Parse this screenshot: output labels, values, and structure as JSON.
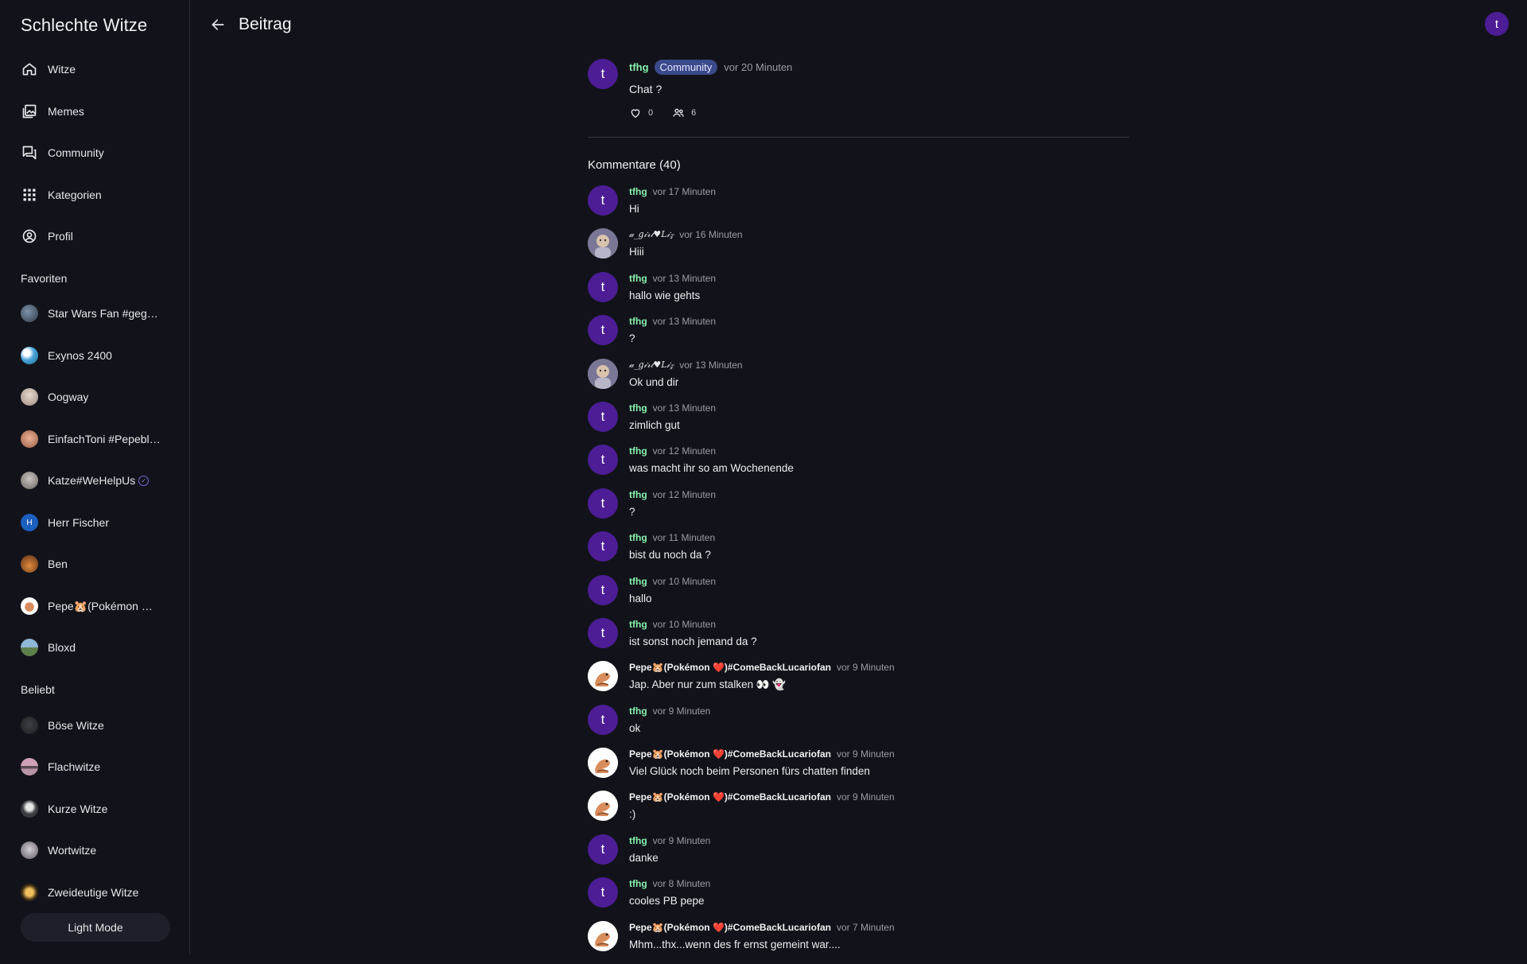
{
  "app": {
    "title": "Schlechte Witze",
    "user_initial": "t"
  },
  "nav": {
    "items": [
      {
        "label": "Witze",
        "icon": "home-icon"
      },
      {
        "label": "Memes",
        "icon": "gallery-icon"
      },
      {
        "label": "Community",
        "icon": "forum-icon"
      },
      {
        "label": "Kategorien",
        "icon": "grid-icon"
      },
      {
        "label": "Profil",
        "icon": "profile-icon"
      }
    ]
  },
  "favorites": {
    "heading": "Favoriten",
    "items": [
      {
        "label": "Star Wars Fan #gegen...",
        "color": "#3a4a5c"
      },
      {
        "label": "Exynos 2400",
        "color": "#4aa3d8"
      },
      {
        "label": "Oogway",
        "color": "#b7a49a"
      },
      {
        "label": "EinfachToni #Pepeblei...",
        "color": "#c4866a"
      },
      {
        "label": "Katze#WeHelpUs",
        "color": "#8d8a86"
      },
      {
        "label": "Herr Fischer",
        "color": "#1d5fbf",
        "initial": "H"
      },
      {
        "label": "Ben",
        "color": "#b5652f"
      },
      {
        "label": "Pepe🐹(Pokémon ❤️)...",
        "color": "#e0b08a"
      },
      {
        "label": "Bloxd",
        "color": "#6c8f6a"
      }
    ]
  },
  "popular": {
    "heading": "Beliebt",
    "items": [
      {
        "label": "Böse Witze",
        "color": "#2b2c30"
      },
      {
        "label": "Flachwitze",
        "color": "#a4708a"
      },
      {
        "label": "Kurze Witze",
        "color": "#5c5f66"
      },
      {
        "label": "Wortwitze",
        "color": "#7b7680"
      },
      {
        "label": "Zweideutige Witze",
        "color": "#8a6a3a"
      }
    ]
  },
  "theme_toggle": {
    "label": "Light Mode"
  },
  "header": {
    "title": "Beitrag"
  },
  "post": {
    "author": "tfhg",
    "initial": "t",
    "badge": "Community",
    "time": "vor 20 Minuten",
    "text": "Chat ?",
    "likes": "0",
    "participants": "6"
  },
  "comments_heading": "Kommentare (40)",
  "comments": [
    {
      "author": "tfhg",
      "avatar": "t",
      "time": "vor 17 Minuten",
      "text": "Hi"
    },
    {
      "author": "𝒶_𝑔𝒾𝓇𝓁♥𝐿𝒾𝓏",
      "avatar": "liz",
      "time": "vor 16 Minuten",
      "text": "Hiii"
    },
    {
      "author": "tfhg",
      "avatar": "t",
      "time": "vor 13 Minuten",
      "text": "hallo wie gehts"
    },
    {
      "author": "tfhg",
      "avatar": "t",
      "time": "vor 13 Minuten",
      "text": "?"
    },
    {
      "author": "𝒶_𝑔𝒾𝓇𝓁♥𝐿𝒾𝓏",
      "avatar": "liz",
      "time": "vor 13 Minuten",
      "text": "Ok und dir"
    },
    {
      "author": "tfhg",
      "avatar": "t",
      "time": "vor 13 Minuten",
      "text": "zimlich gut"
    },
    {
      "author": "tfhg",
      "avatar": "t",
      "time": "vor 12 Minuten",
      "text": "was macht ihr so am Wochenende"
    },
    {
      "author": "tfhg",
      "avatar": "t",
      "time": "vor 12 Minuten",
      "text": "?"
    },
    {
      "author": "tfhg",
      "avatar": "t",
      "time": "vor 11 Minuten",
      "text": "bist du noch da ?"
    },
    {
      "author": "tfhg",
      "avatar": "t",
      "time": "vor 10 Minuten",
      "text": "hallo"
    },
    {
      "author": "tfhg",
      "avatar": "t",
      "time": "vor 10 Minuten",
      "text": "ist sonst noch jemand da ?"
    },
    {
      "author": "Pepe🐹(Pokémon ❤️)#ComeBackLucariofan",
      "avatar": "pepe",
      "time": "vor 9 Minuten",
      "text": "Jap. Aber nur zum stalken 👀 👻"
    },
    {
      "author": "tfhg",
      "avatar": "t",
      "time": "vor 9 Minuten",
      "text": "ok"
    },
    {
      "author": "Pepe🐹(Pokémon ❤️)#ComeBackLucariofan",
      "avatar": "pepe",
      "time": "vor 9 Minuten",
      "text": "Viel Glück noch beim Personen fürs chatten finden"
    },
    {
      "author": "Pepe🐹(Pokémon ❤️)#ComeBackLucariofan",
      "avatar": "pepe",
      "time": "vor 9 Minuten",
      "text": ":)"
    },
    {
      "author": "tfhg",
      "avatar": "t",
      "time": "vor 9 Minuten",
      "text": "danke"
    },
    {
      "author": "tfhg",
      "avatar": "t",
      "time": "vor 8 Minuten",
      "text": "cooles PB pepe"
    },
    {
      "author": "Pepe🐹(Pokémon ❤️)#ComeBackLucariofan",
      "avatar": "pepe",
      "time": "vor 7 Minuten",
      "text": "Mhm...thx...wenn des fr ernst gemeint war...."
    }
  ],
  "colors": {
    "background": "#12131a",
    "accent_avatar": "#4c1d95",
    "author_green": "#86efac",
    "badge_bg": "#3b4a8c"
  }
}
